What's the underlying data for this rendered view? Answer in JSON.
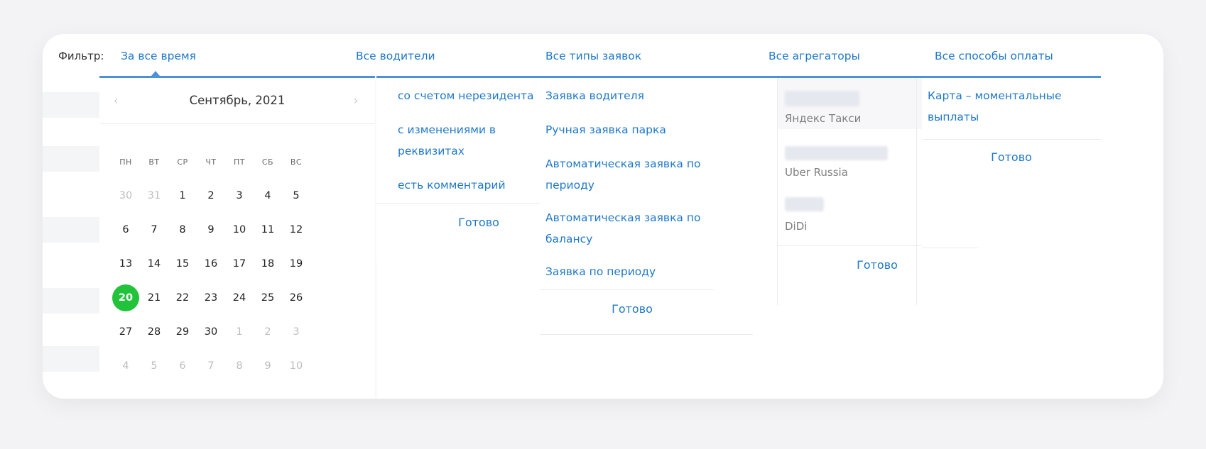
{
  "filter": {
    "label": "Фильтр:",
    "tabs": [
      {
        "label": "За все время"
      },
      {
        "label": "Все водители"
      },
      {
        "label": "Все типы заявок"
      },
      {
        "label": "Все агрегаторы"
      },
      {
        "label": "Все способы оплаты"
      }
    ]
  },
  "calendar": {
    "prev": "‹",
    "next": "›",
    "title": "Сентябрь, 2021",
    "weekdays": [
      "ПН",
      "ВТ",
      "СР",
      "ЧТ",
      "ПТ",
      "СБ",
      "ВС"
    ],
    "weeks": [
      [
        {
          "d": "30",
          "m": true
        },
        {
          "d": "31",
          "m": true
        },
        {
          "d": "1"
        },
        {
          "d": "2"
        },
        {
          "d": "3"
        },
        {
          "d": "4"
        },
        {
          "d": "5"
        }
      ],
      [
        {
          "d": "6"
        },
        {
          "d": "7"
        },
        {
          "d": "8"
        },
        {
          "d": "9"
        },
        {
          "d": "10"
        },
        {
          "d": "11"
        },
        {
          "d": "12"
        }
      ],
      [
        {
          "d": "13"
        },
        {
          "d": "14"
        },
        {
          "d": "15"
        },
        {
          "d": "16"
        },
        {
          "d": "17"
        },
        {
          "d": "18"
        },
        {
          "d": "19"
        }
      ],
      [
        {
          "d": "20",
          "t": true
        },
        {
          "d": "21"
        },
        {
          "d": "22"
        },
        {
          "d": "23"
        },
        {
          "d": "24"
        },
        {
          "d": "25"
        },
        {
          "d": "26"
        }
      ],
      [
        {
          "d": "27"
        },
        {
          "d": "28"
        },
        {
          "d": "29"
        },
        {
          "d": "30"
        },
        {
          "d": "1",
          "m": true
        },
        {
          "d": "2",
          "m": true
        },
        {
          "d": "3",
          "m": true
        }
      ],
      [
        {
          "d": "4",
          "m": true
        },
        {
          "d": "5",
          "m": true
        },
        {
          "d": "6",
          "m": true
        },
        {
          "d": "7",
          "m": true
        },
        {
          "d": "8",
          "m": true
        },
        {
          "d": "9",
          "m": true
        },
        {
          "d": "10",
          "m": true
        }
      ]
    ]
  },
  "drivers": {
    "options": [
      {
        "label": "со счетом нерезидента"
      },
      {
        "label": "с изменениями в реквизитах"
      },
      {
        "label": "есть комментарий"
      }
    ],
    "done": "Готово"
  },
  "request_types": {
    "options": [
      {
        "label": "Заявка водителя"
      },
      {
        "label": "Ручная заявка парка"
      },
      {
        "label": "Автоматическая заявка по периоду"
      },
      {
        "label": "Автоматическая заявка по балансу"
      },
      {
        "label": "Заявка по периоду"
      }
    ],
    "done": "Готово"
  },
  "aggregators": {
    "items": [
      {
        "label": "Яндекс Такси"
      },
      {
        "label": "Uber Russia"
      },
      {
        "label": "DiDi"
      }
    ],
    "done": "Готово"
  },
  "payment": {
    "options": [
      {
        "label": "Карта – моментальные выплаты"
      }
    ],
    "done": "Готово"
  },
  "colors": {
    "accent": "#1f78c8",
    "today": "#21c33b"
  }
}
